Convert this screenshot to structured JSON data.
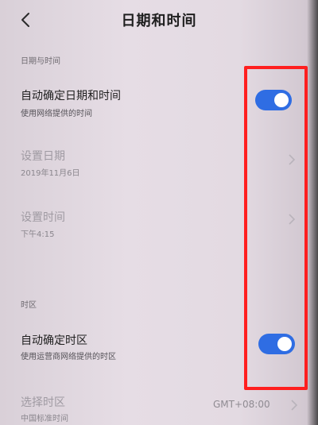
{
  "header": {
    "title": "日期和时间",
    "back_icon": "back-chevron-icon"
  },
  "sections": {
    "date_time_label": "日期与时间",
    "timezone_label": "时区"
  },
  "rows": {
    "auto_datetime": {
      "title": "自动确定日期和时间",
      "subtitle": "使用网络提供的时间",
      "toggle_on": true
    },
    "set_date": {
      "title": "设置日期",
      "subtitle": "2019年11月6日",
      "enabled": false
    },
    "set_time": {
      "title": "设置时间",
      "subtitle": "下午4:15",
      "enabled": false
    },
    "auto_timezone": {
      "title": "自动确定时区",
      "subtitle": "使用运营商网络提供的时区",
      "toggle_on": true
    },
    "select_timezone": {
      "title": "选择时区",
      "subtitle": "中国标准时间",
      "value": "GMT+08:00",
      "enabled": false
    }
  },
  "colors": {
    "toggle_on": "#2f6de3",
    "highlight": "#ff1f1f",
    "background": "#e6dde5"
  }
}
